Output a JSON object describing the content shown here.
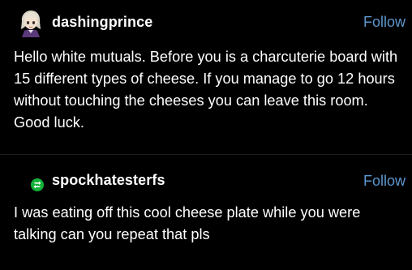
{
  "posts": [
    {
      "username": "dashingprince",
      "follow_label": "Follow",
      "avatar_icon": "anime-character-avatar-icon",
      "body": "Hello white mutuals. Before you is a charcuterie board with 15 different types of cheese. If you manage to go 12 hours without touching the cheeses you can leave this room. Good luck."
    },
    {
      "username": "spockhatesterfs",
      "follow_label": "Follow",
      "avatar_icon": "reblog-icon",
      "body": "I was eating off this cool cheese plate while you were talking can you repeat that pls"
    }
  ],
  "colors": {
    "background": "#000000",
    "text": "#ffffff",
    "follow": "#5d96cd",
    "reblog_green": "#12b23a"
  }
}
